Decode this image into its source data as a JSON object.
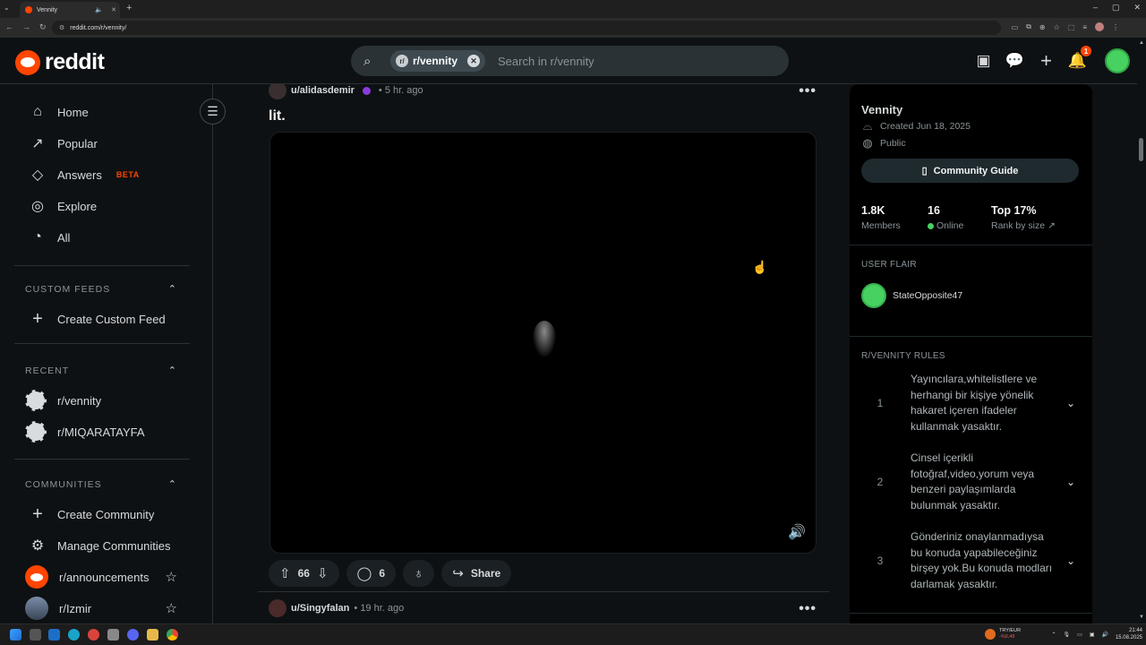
{
  "browser": {
    "tab_title": "Vennity",
    "url": "reddit.com/r/vennity/"
  },
  "header": {
    "logo_text": "reddit",
    "search_chip": "r/vennity",
    "search_placeholder": "Search in r/vennity",
    "notification_count": "1"
  },
  "sidebar": {
    "nav": [
      {
        "label": "Home"
      },
      {
        "label": "Popular"
      },
      {
        "label": "Answers",
        "badge": "BETA"
      },
      {
        "label": "Explore"
      },
      {
        "label": "All"
      }
    ],
    "custom_feeds": {
      "header": "CUSTOM FEEDS",
      "create": "Create Custom Feed"
    },
    "recent": {
      "header": "RECENT",
      "items": [
        "r/vennity",
        "r/MIQARATAYFA"
      ]
    },
    "communities": {
      "header": "COMMUNITIES",
      "create": "Create Community",
      "manage": "Manage Communities",
      "items": [
        "r/announcements",
        "r/Izmir"
      ]
    }
  },
  "feed": {
    "post1": {
      "author": "u/alidasdemir",
      "time": "• 5 hr. ago",
      "title": "lit.",
      "votes": "66",
      "comments": "6",
      "share": "Share"
    },
    "post2": {
      "author": "u/Singyfalan",
      "time": "• 19 hr. ago"
    }
  },
  "community": {
    "name": "Vennity",
    "created": "Created Jun 18, 2025",
    "visibility": "Public",
    "guide_button": "Community Guide",
    "stats": [
      {
        "value": "1.8K",
        "label": "Members"
      },
      {
        "value": "16",
        "label": "Online"
      },
      {
        "value": "Top 17%",
        "label": "Rank by size"
      }
    ],
    "user_flair_header": "USER FLAIR",
    "user_flair_name": "StateOpposite47",
    "rules_header": "R/VENNITY RULES",
    "rules": [
      {
        "num": "1",
        "text": "Yayıncılara,whitelistlere ve herhangi bir kişiye yönelik hakaret içeren ifadeler kullanmak yasaktır."
      },
      {
        "num": "2",
        "text": "Cinsel içerikli fotoğraf,video,yorum veya benzeri paylaşımlarda bulunmak yasaktır."
      },
      {
        "num": "3",
        "text": "Gönderiniz onaylanmadıysa bu konuda yapabileceğiniz birşey yok.Bu konuda modları darlamak yasaktır."
      }
    ]
  },
  "taskbar": {
    "currency_pair": "TRY/EUR",
    "currency_change": "-%0,48",
    "time": "21:44",
    "date": "15.08.2025"
  },
  "colors": {
    "accent": "#ff4500",
    "background": "#0e1113",
    "online": "#46d160"
  }
}
